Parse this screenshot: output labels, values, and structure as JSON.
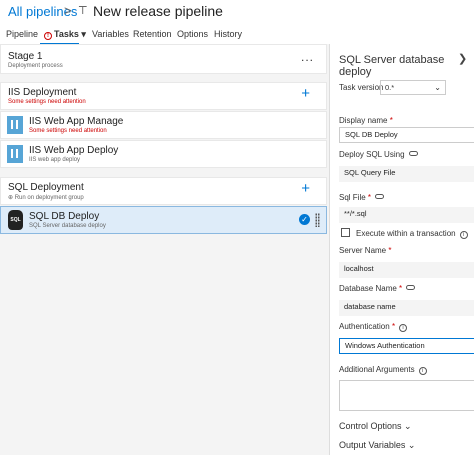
{
  "breadcrumb": {
    "root": "All pipelines",
    "separator": ">",
    "title": "New release pipeline"
  },
  "tabs": [
    "Pipeline",
    "Tasks",
    "Variables",
    "Retention",
    "Options",
    "History"
  ],
  "tasks_tab_warning_icon": "warning-circle-icon",
  "stage": {
    "title": "Stage 1",
    "subtitle": "Deployment process",
    "menu": "..."
  },
  "groups": [
    {
      "title": "IIS Deployment",
      "warning": "Some settings need attention"
    },
    {
      "title": "SQL Deployment",
      "subtitle": "Run on deployment group"
    }
  ],
  "tasks": [
    {
      "name": "IIS Web App Manage",
      "warning": "Some settings need attention",
      "icon": "iis-icon"
    },
    {
      "name": "IIS Web App Deploy",
      "subtitle": "IIS web app deploy",
      "icon": "iis-icon"
    },
    {
      "name": "SQL DB Deploy",
      "subtitle": "SQL Server database deploy",
      "icon": "sql-icon",
      "icon_text": "SQL",
      "selected": true
    }
  ],
  "panel": {
    "title": "SQL Server database deploy",
    "task_version_label": "Task version",
    "task_version_value": "0.*",
    "display_name_label": "Display name",
    "display_name_value": "SQL DB Deploy",
    "deploy_using_label": "Deploy SQL Using",
    "deploy_using_value": "SQL Query File",
    "sql_file_label": "Sql File",
    "sql_file_value": "**/*.sql",
    "transaction_label": "Execute within a transaction",
    "server_name_label": "Server Name",
    "server_name_value": "localhost",
    "database_name_label": "Database Name",
    "database_name_value": "database name",
    "authentication_label": "Authentication",
    "authentication_value": "Windows Authentication",
    "additional_args_label": "Additional Arguments",
    "control_options": "Control Options",
    "output_variables": "Output Variables",
    "required_mark": "*"
  },
  "colors": {
    "accent": "#0078d4",
    "warning": "#c00000",
    "selected_bg": "#deecf9"
  }
}
